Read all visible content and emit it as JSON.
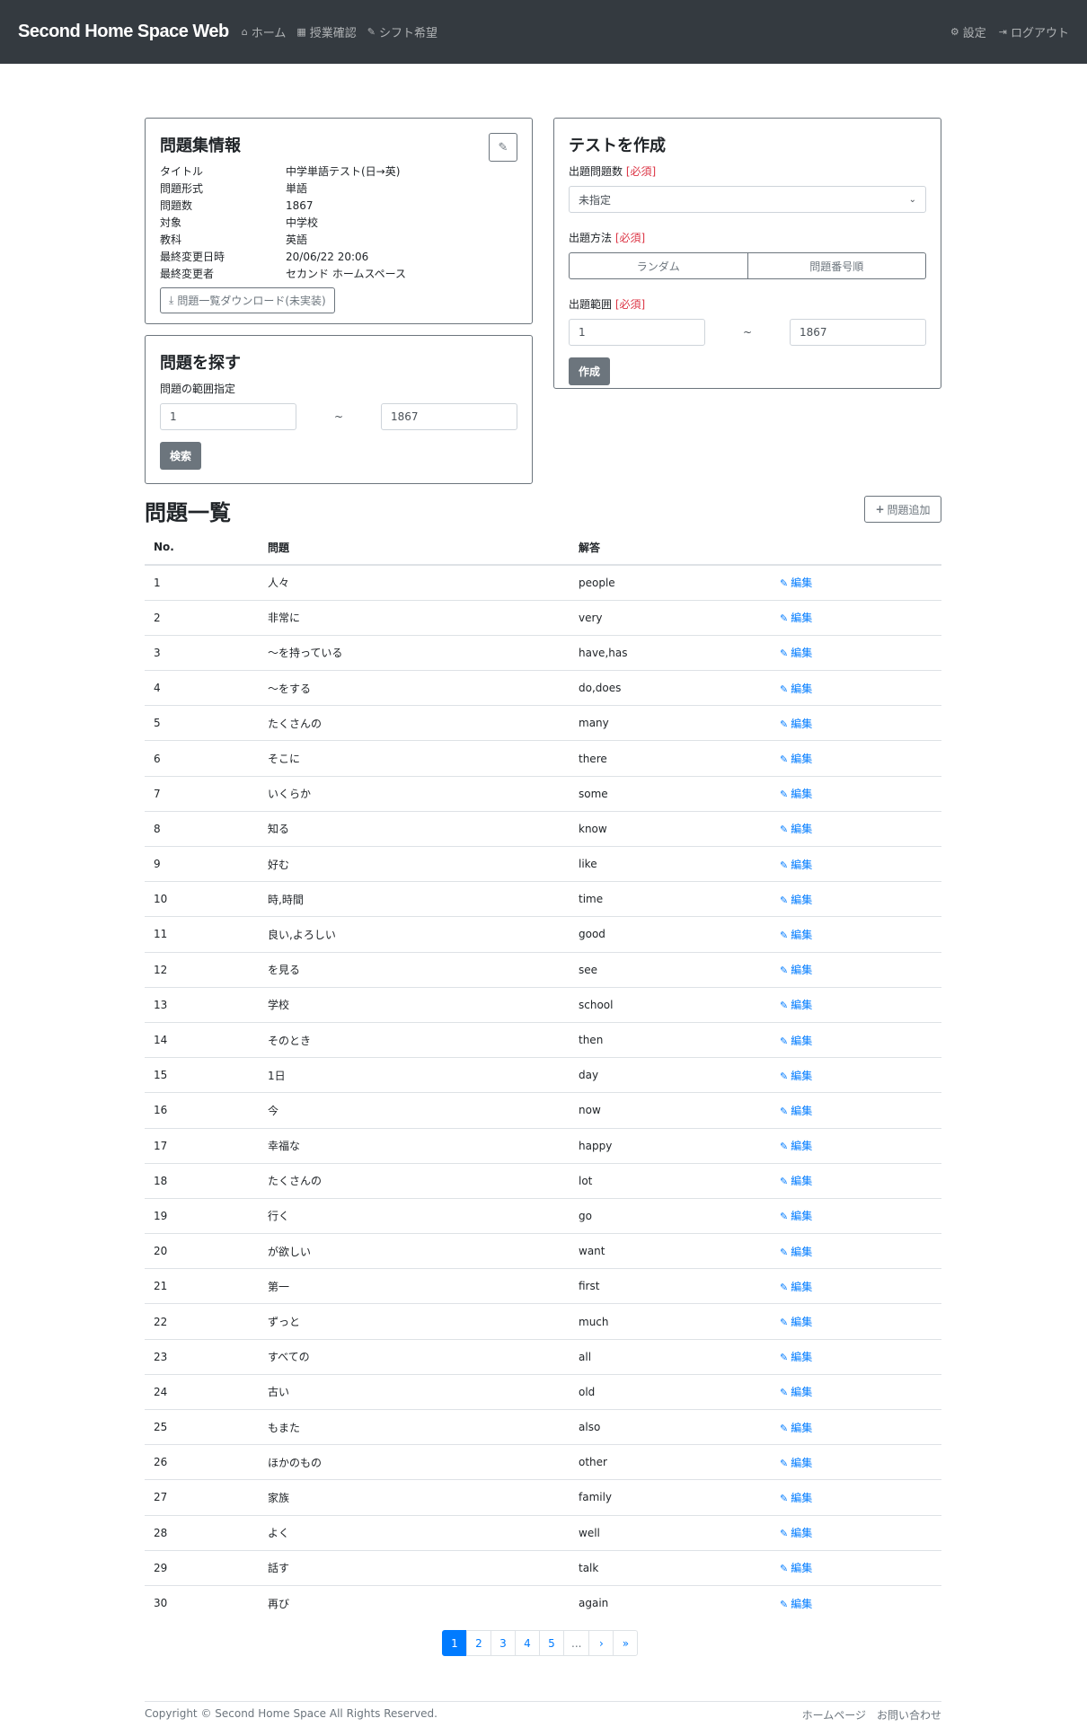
{
  "navbar": {
    "brand": "Second Home Space Web",
    "links": [
      {
        "icon": "home-icon",
        "glyph": "⌂",
        "label": "ホーム"
      },
      {
        "icon": "calendar-icon",
        "glyph": "▦",
        "label": "授業確認"
      },
      {
        "icon": "pencil-icon",
        "glyph": "✎",
        "label": "シフト希望"
      }
    ],
    "right": [
      {
        "icon": "gear-icon",
        "glyph": "⚙",
        "label": "設定"
      },
      {
        "icon": "logout-icon",
        "glyph": "⇥",
        "label": "ログアウト"
      }
    ]
  },
  "info": {
    "title": "問題集情報",
    "rows": [
      {
        "k": "タイトル",
        "v": "中学単語テスト(日→英)"
      },
      {
        "k": "問題形式",
        "v": "単語"
      },
      {
        "k": "問題数",
        "v": "1867"
      },
      {
        "k": "対象",
        "v": "中学校"
      },
      {
        "k": "教科",
        "v": "英語"
      },
      {
        "k": "最終変更日時",
        "v": "20/06/22 20:06"
      },
      {
        "k": "最終変更者",
        "v": "セカンド ホームスペース"
      }
    ],
    "download_label": "問題一覧ダウンロード(未実装)"
  },
  "search": {
    "title": "問題を探す",
    "range_label": "問題の範囲指定",
    "from": "1",
    "to": "1867",
    "tilde": "~",
    "button": "検索"
  },
  "create": {
    "title": "テストを作成",
    "count_label": "出題問題数",
    "required": "[必須]",
    "count_value": "未指定",
    "method_label": "出題方法",
    "method_options": [
      "ランダム",
      "問題番号順"
    ],
    "range_label": "出題範囲",
    "from": "1",
    "to": "1867",
    "tilde": "~",
    "button": "作成"
  },
  "list": {
    "title": "問題一覧",
    "add_label": "問題追加",
    "headers": [
      "No.",
      "問題",
      "解答",
      ""
    ],
    "edit_label": "編集",
    "rows": [
      [
        "1",
        "人々",
        "people"
      ],
      [
        "2",
        "非常に",
        "very"
      ],
      [
        "3",
        "～を持っている",
        "have,has"
      ],
      [
        "4",
        "～をする",
        "do,does"
      ],
      [
        "5",
        "たくさんの",
        "many"
      ],
      [
        "6",
        "そこに",
        "there"
      ],
      [
        "7",
        "いくらか",
        "some"
      ],
      [
        "8",
        "知る",
        "know"
      ],
      [
        "9",
        "好む",
        "like"
      ],
      [
        "10",
        "時,時間",
        "time"
      ],
      [
        "11",
        "良い,よろしい",
        "good"
      ],
      [
        "12",
        "を見る",
        "see"
      ],
      [
        "13",
        "学校",
        "school"
      ],
      [
        "14",
        "そのとき",
        "then"
      ],
      [
        "15",
        "1日",
        "day"
      ],
      [
        "16",
        "今",
        "now"
      ],
      [
        "17",
        "幸福な",
        "happy"
      ],
      [
        "18",
        "たくさんの",
        "lot"
      ],
      [
        "19",
        "行く",
        "go"
      ],
      [
        "20",
        "が欲しい",
        "want"
      ],
      [
        "21",
        "第一",
        "first"
      ],
      [
        "22",
        "ずっと",
        "much"
      ],
      [
        "23",
        "すべての",
        "all"
      ],
      [
        "24",
        "古い",
        "old"
      ],
      [
        "25",
        "もまた",
        "also"
      ],
      [
        "26",
        "ほかのもの",
        "other"
      ],
      [
        "27",
        "家族",
        "family"
      ],
      [
        "28",
        "よく",
        "well"
      ],
      [
        "29",
        "話す",
        "talk"
      ],
      [
        "30",
        "再び",
        "again"
      ]
    ]
  },
  "pagination": {
    "pages": [
      "1",
      "2",
      "3",
      "4",
      "5",
      "...",
      "›",
      "»"
    ],
    "active": "1"
  },
  "footer": {
    "copyright": "Copyright © Second Home Space All Rights Reserved.",
    "links": [
      "ホームページ",
      "お問い合わせ"
    ]
  }
}
